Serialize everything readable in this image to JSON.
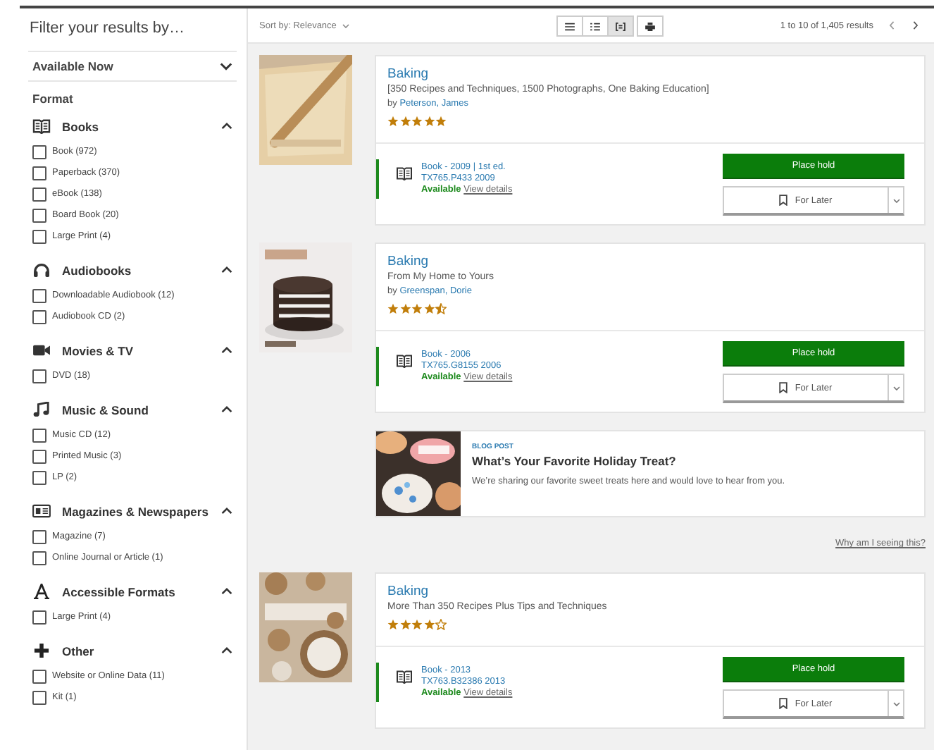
{
  "sidebar": {
    "title": "Filter your results by…",
    "sections": [
      {
        "label": "Available Now",
        "expanded": false
      }
    ],
    "format_heading": "Format",
    "groups": [
      {
        "kind": "book",
        "label": "Books",
        "expanded": true,
        "options": [
          {
            "label": "Book (972)",
            "checked": false
          },
          {
            "label": "Paperback (370)",
            "checked": false
          },
          {
            "label": "eBook (138)",
            "checked": false
          },
          {
            "label": "Board Book (20)",
            "checked": false
          },
          {
            "label": "Large Print (4)",
            "checked": false
          }
        ]
      },
      {
        "kind": "headphones",
        "label": "Audiobooks",
        "expanded": true,
        "options": [
          {
            "label": "Downloadable Audiobook (12)",
            "checked": false
          },
          {
            "label": "Audiobook CD (2)",
            "checked": false
          }
        ]
      },
      {
        "kind": "camera",
        "label": "Movies & TV",
        "expanded": true,
        "options": [
          {
            "label": "DVD (18)",
            "checked": false
          }
        ]
      },
      {
        "kind": "music",
        "label": "Music & Sound",
        "expanded": true,
        "options": [
          {
            "label": "Music CD (12)",
            "checked": false
          },
          {
            "label": "Printed Music (3)",
            "checked": false
          },
          {
            "label": "LP (2)",
            "checked": false
          }
        ]
      },
      {
        "kind": "newspaper",
        "label": "Magazines & Newspapers",
        "expanded": true,
        "options": [
          {
            "label": "Magazine (7)",
            "checked": false
          },
          {
            "label": "Online Journal or Article (1)",
            "checked": false
          }
        ]
      },
      {
        "kind": "letter",
        "label": "Accessible Formats",
        "expanded": true,
        "options": [
          {
            "label": "Large Print (4)",
            "checked": false
          }
        ]
      },
      {
        "kind": "plus",
        "label": "Other",
        "expanded": true,
        "options": [
          {
            "label": "Website or Online Data (11)",
            "checked": false
          },
          {
            "label": "Kit (1)",
            "checked": false
          }
        ]
      }
    ]
  },
  "toolbar": {
    "sort": "Sort by: Relevance",
    "view_modes": [
      {
        "kind": "compact",
        "selected": false
      },
      {
        "kind": "list",
        "selected": false
      },
      {
        "kind": "medium",
        "selected": true
      },
      {
        "kind": "print",
        "selected": false
      }
    ],
    "pagination": "1 to 10 of 1,405 results"
  },
  "results": [
    {
      "kind": "book",
      "title": "Baking",
      "subtitle": "[350 Recipes and Techniques, 1500 Photographs, One Baking Education]",
      "author_prefix": "by",
      "author": "Peterson, James",
      "stars": 5,
      "format": "Book - 2009 | 1st ed.",
      "call_number": "TX765.P433 2009",
      "availability": "Available",
      "details_link": "View details",
      "hold_button": "Place hold",
      "later_button": "For Later"
    },
    {
      "kind": "book",
      "title": "Baking",
      "subtitle": "From My Home to Yours",
      "author_prefix": "by",
      "author": "Greenspan, Dorie",
      "stars": 4.5,
      "format": "Book - 2006",
      "call_number": "TX765.G8155 2006",
      "availability": "Available",
      "details_link": "View details",
      "hold_button": "Place hold",
      "later_button": "For Later"
    },
    {
      "kind": "blog",
      "label": "BLOG POST",
      "title": "What’s Your Favorite Holiday Treat?",
      "text": "We’re sharing our favorite sweet treats here and would love to hear from you.",
      "why_link": "Why am I seeing this?"
    },
    {
      "kind": "book",
      "title": "Baking",
      "subtitle": "More Than 350 Recipes Plus Tips and Techniques",
      "stars": 4,
      "format": "Book - 2013",
      "call_number": "TX763.B32386 2013",
      "availability": "Available",
      "details_link": "View details",
      "hold_button": "Place hold",
      "later_button": "For Later"
    }
  ]
}
